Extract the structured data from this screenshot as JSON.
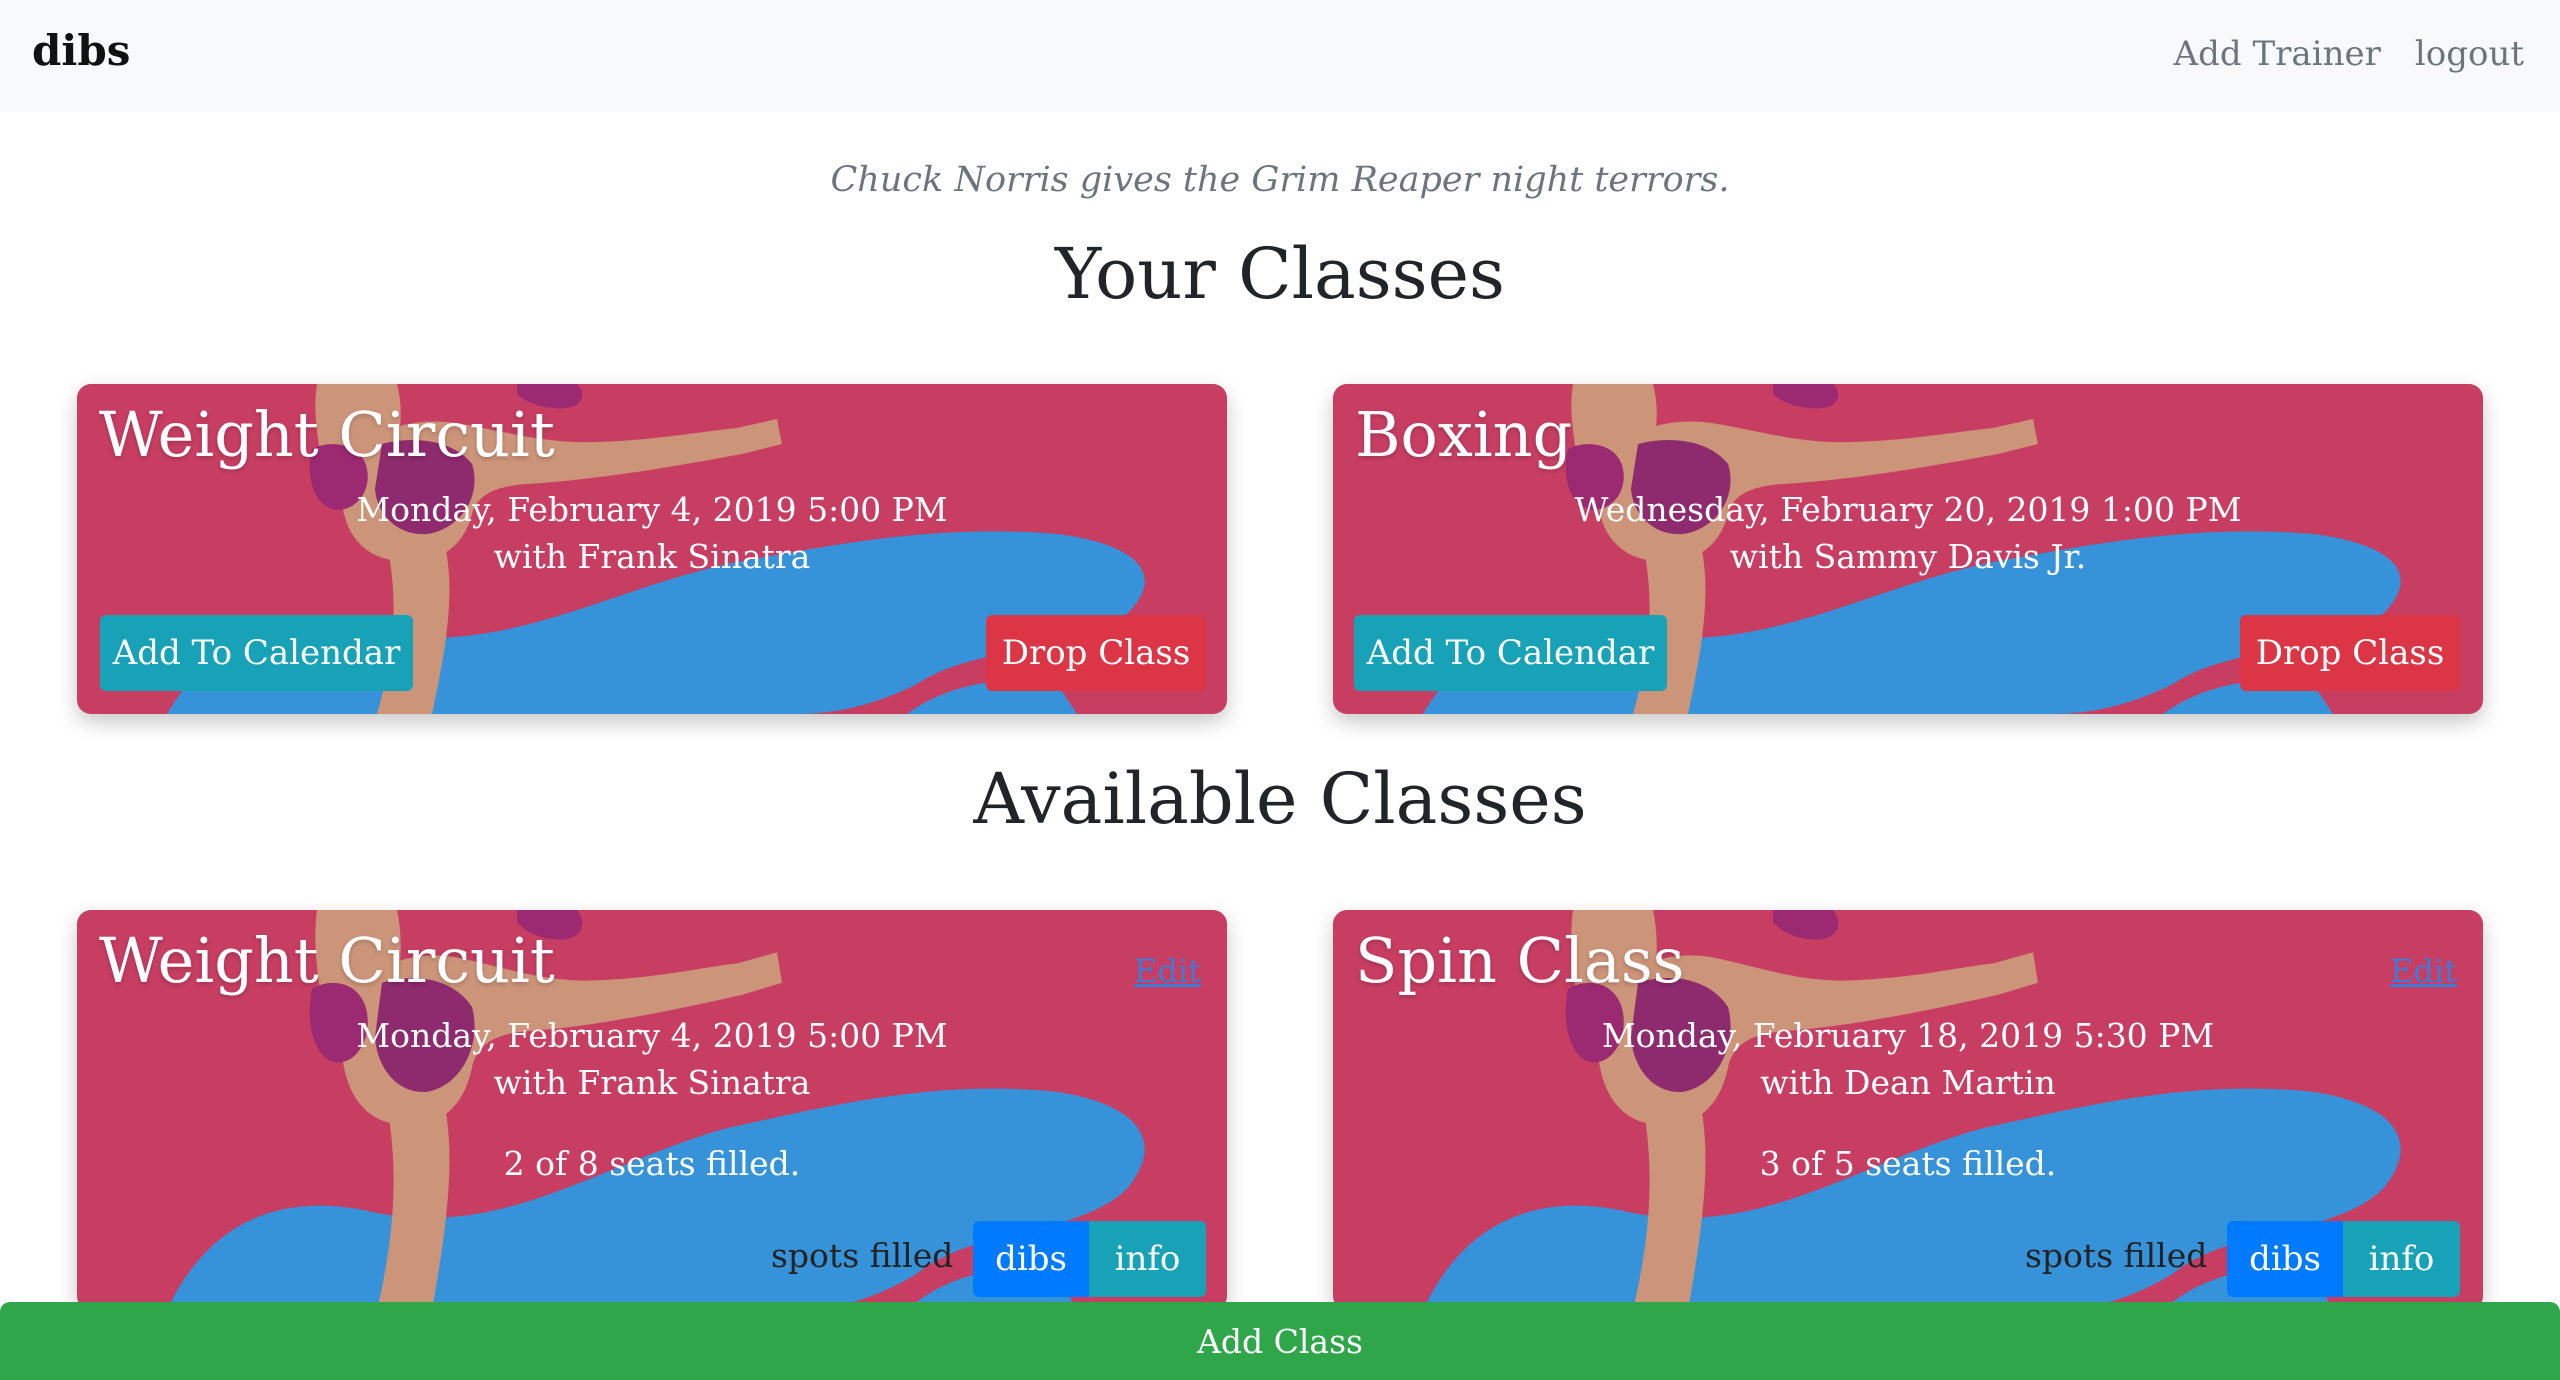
{
  "navbar": {
    "brand": "dibs",
    "links": [
      "Add Trainer",
      "logout"
    ]
  },
  "quote": "Chuck Norris gives the Grim Reaper night terrors.",
  "your_classes": {
    "heading": "Your Classes",
    "cards": [
      {
        "title": "Weight Circuit",
        "when": "Monday, February 4, 2019 5:00 PM",
        "trainer": "with Frank Sinatra",
        "calendar_button": "Add To Calendar",
        "drop_button": "Drop Class"
      },
      {
        "title": "Boxing",
        "when": "Wednesday, February 20, 2019 1:00 PM",
        "trainer": "with Sammy Davis Jr.",
        "calendar_button": "Add To Calendar",
        "drop_button": "Drop Class"
      }
    ]
  },
  "available_classes": {
    "heading": "Available Classes",
    "cards": [
      {
        "title": "Weight Circuit",
        "edit": "Edit",
        "when": "Monday, February 4, 2019 5:00 PM",
        "trainer": "with Frank Sinatra",
        "seats": "2 of 8 seats filled.",
        "spots_label": "spots filled",
        "dibs_button": "dibs",
        "info_button": "info"
      },
      {
        "title": "Spin Class",
        "edit": "Edit",
        "when": "Monday, February 18, 2019 5:30 PM",
        "trainer": "with Dean Martin",
        "seats": "3 of 5 seats filled.",
        "spots_label": "spots filled",
        "dibs_button": "dibs",
        "info_button": "info"
      }
    ]
  },
  "add_class_button": "Add Class",
  "colors": {
    "card_background": "#c73e62",
    "teal_button": "#17a2b8",
    "red_button": "#dc3545",
    "blue_button": "#007bff",
    "add_class_bar": "#30a64a"
  }
}
